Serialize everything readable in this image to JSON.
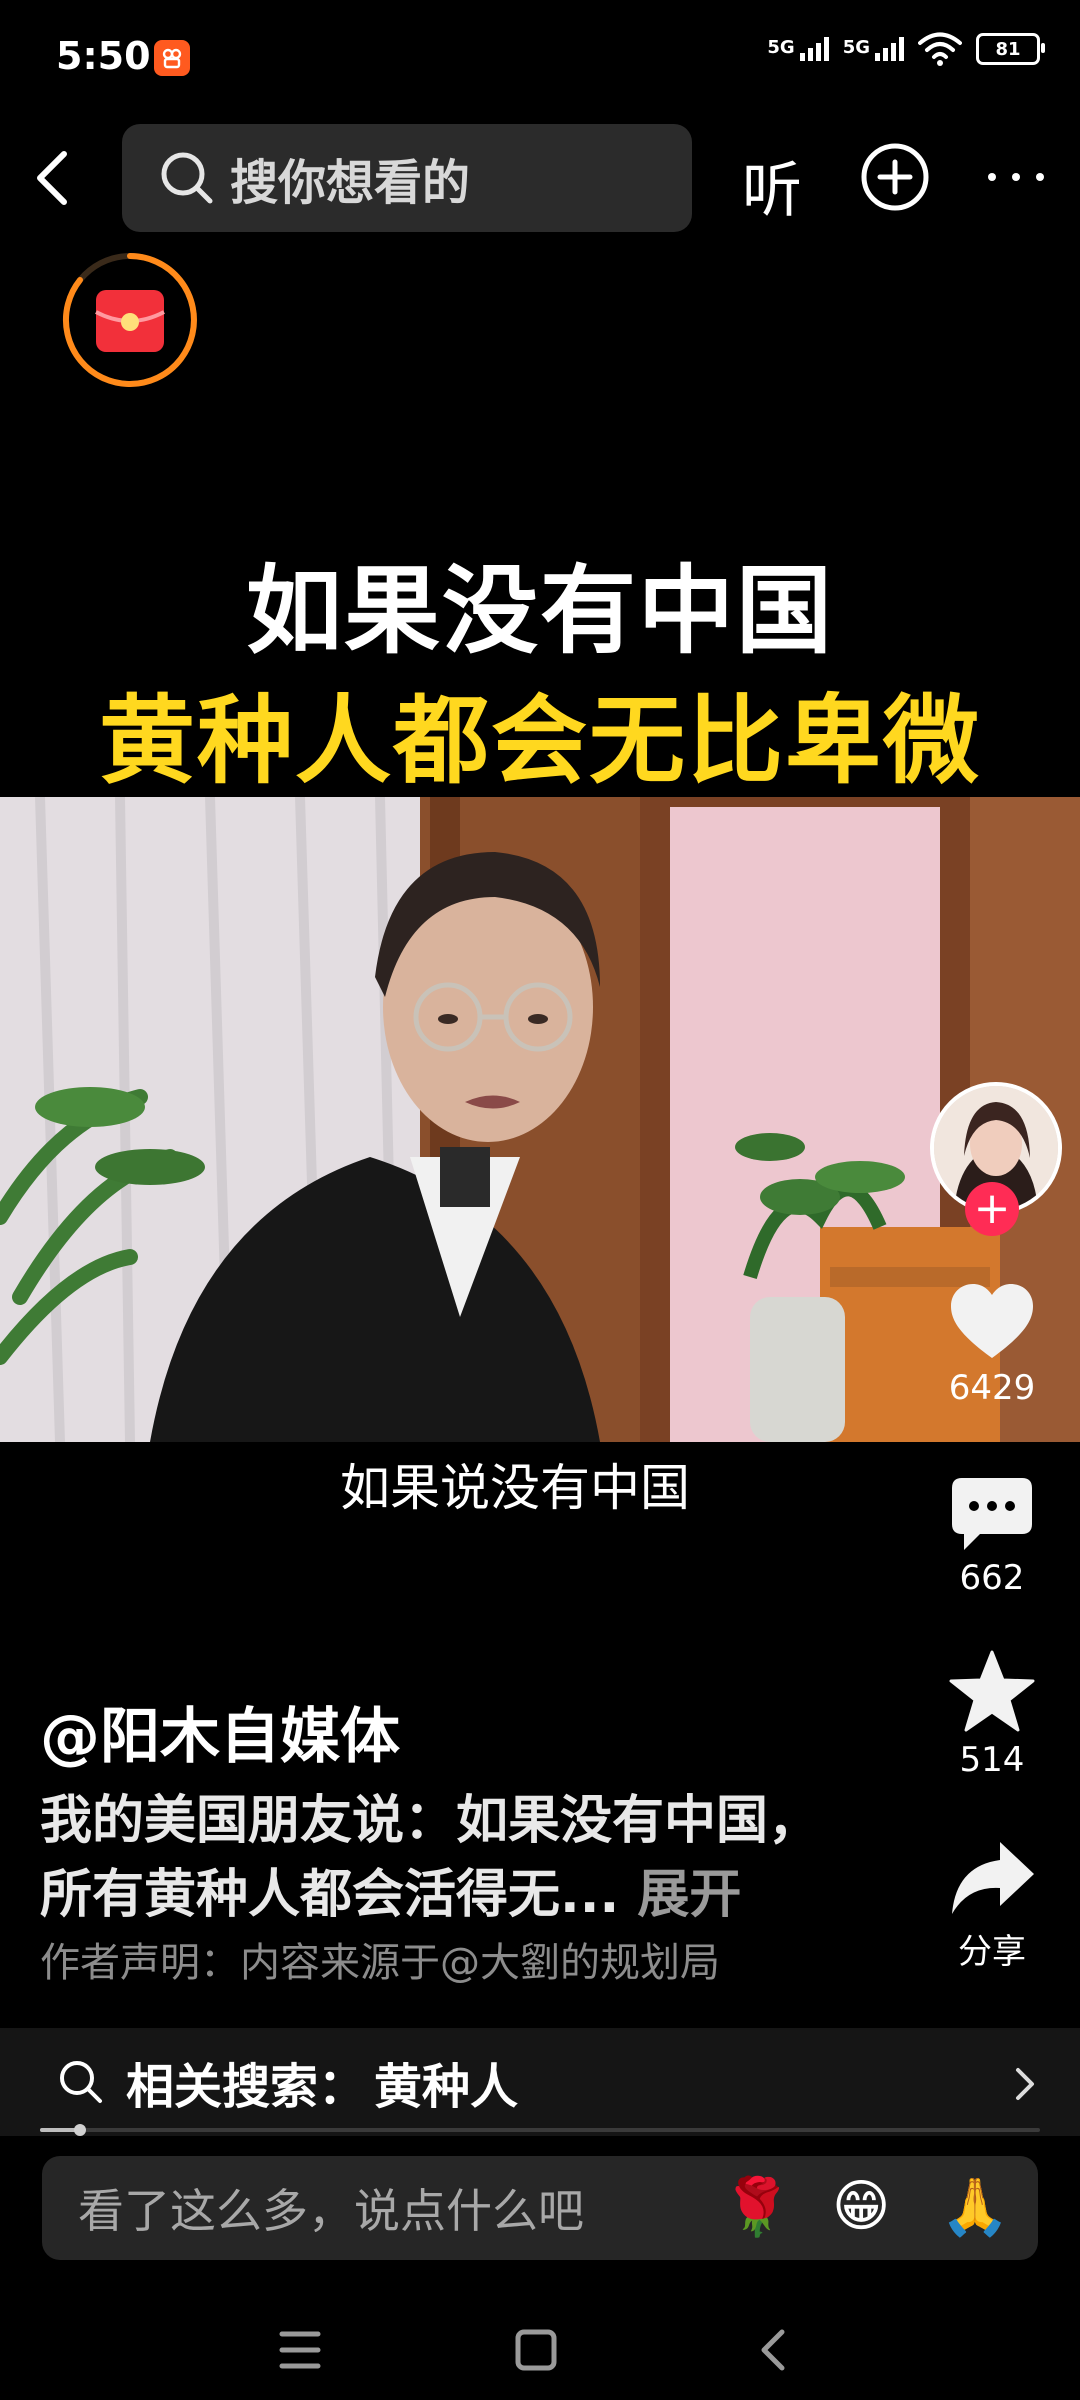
{
  "status_bar": {
    "time": "5:50",
    "signal1_label": "5G",
    "signal2_label": "5G",
    "battery": "81",
    "app_icon": "kuaishou-icon",
    "accent": "#ff5a1f"
  },
  "top_nav": {
    "search_placeholder": "搜你想看的",
    "listen_label": "听",
    "icons": [
      "back-icon",
      "search-icon",
      "plus-circle-icon",
      "more-icon"
    ]
  },
  "video": {
    "headline_line1": "如果没有中国",
    "headline_line2": "黄种人都会无比卑微",
    "headline_color": "#ffd81f",
    "subtitle": "如果说没有中国"
  },
  "rail": {
    "likes": "6429",
    "comments": "662",
    "favorites": "514",
    "share_label": "分享",
    "follow_color": "#ff2c55"
  },
  "caption": {
    "author": "@阳木自媒体",
    "line1": "我的美国朋友说：如果没有中国，",
    "line2": "所有黄种人都会活得无...",
    "expand_label": "展开",
    "declaration": "作者声明：内容来源于@大劉的规划局"
  },
  "related_search": {
    "label": "相关搜索：",
    "term": "黄种人"
  },
  "playback": {
    "progress_percent": 4
  },
  "comment_input": {
    "placeholder": "看了这么多，说点什么吧",
    "emojis": [
      "🌹",
      "😁",
      "🙏"
    ]
  }
}
